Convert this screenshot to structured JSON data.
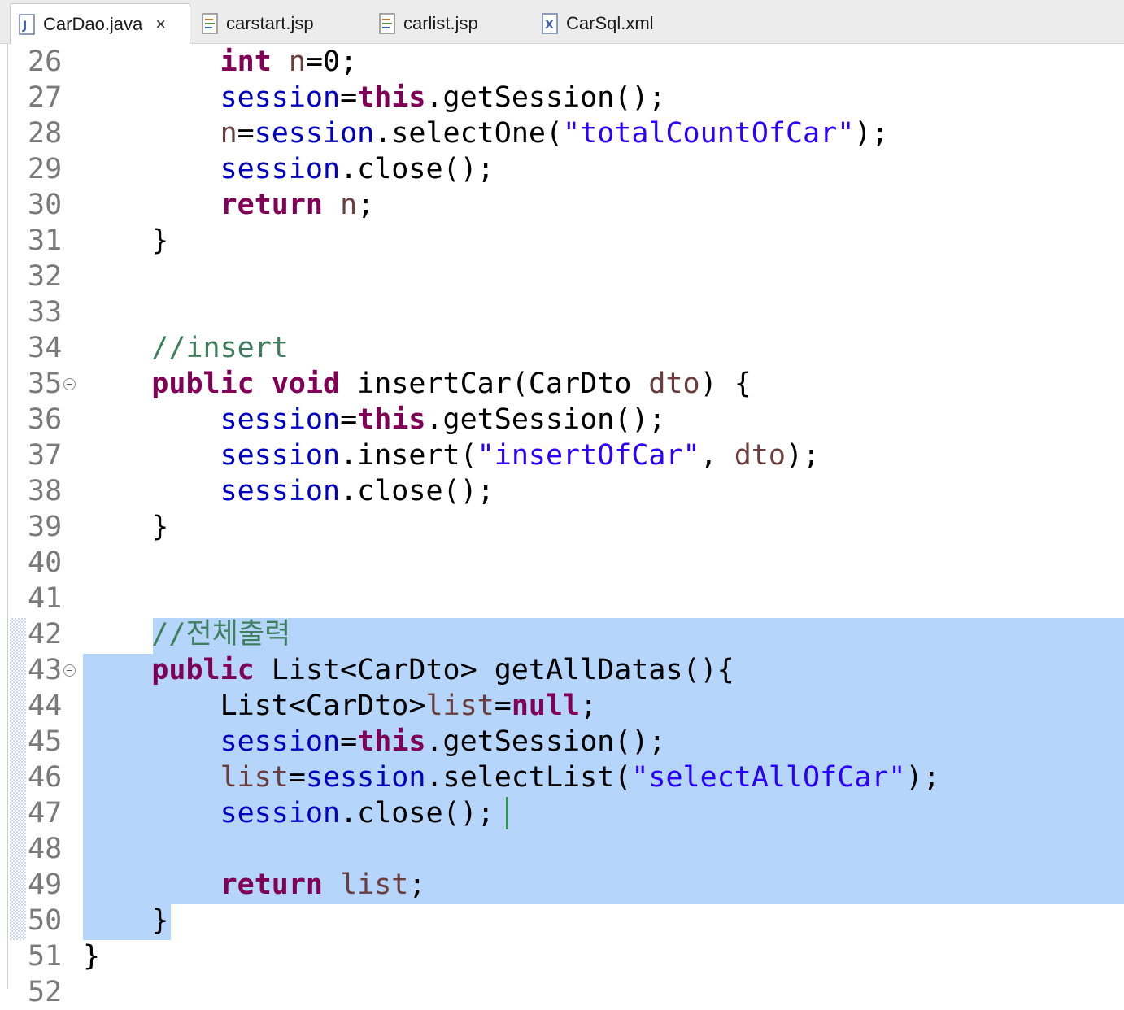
{
  "tabs": [
    {
      "label": "CarDao.java",
      "icon": "java-file-icon",
      "active": true
    },
    {
      "label": "carstart.jsp",
      "icon": "jsp-file-icon",
      "active": false
    },
    {
      "label": "carlist.jsp",
      "icon": "jsp-file-icon",
      "active": false
    },
    {
      "label": "CarSql.xml",
      "icon": "xml-file-icon",
      "active": false
    }
  ],
  "close_icon": "×",
  "colors": {
    "keyword": "#7f0055",
    "field": "#0000c0",
    "string": "#2a00ff",
    "local_var": "#6a3e3e",
    "comment": "#3f7f5f",
    "selection": "#b6d5fb"
  },
  "editor": {
    "lines": [
      {
        "num": "26",
        "tokens": [
          [
            "",
            "        "
          ],
          [
            "kw",
            "int"
          ],
          [
            "",
            " "
          ],
          [
            "var",
            "n"
          ],
          [
            "",
            "=0;"
          ]
        ]
      },
      {
        "num": "27",
        "tokens": [
          [
            "",
            "        "
          ],
          [
            "fld",
            "session"
          ],
          [
            "",
            "="
          ],
          [
            "kw",
            "this"
          ],
          [
            "",
            ".getSession();"
          ]
        ]
      },
      {
        "num": "28",
        "tokens": [
          [
            "",
            "        "
          ],
          [
            "var",
            "n"
          ],
          [
            "",
            "="
          ],
          [
            "fld",
            "session"
          ],
          [
            "",
            ".selectOne("
          ],
          [
            "str",
            "\"totalCountOfCar\""
          ],
          [
            "",
            ");"
          ]
        ]
      },
      {
        "num": "29",
        "tokens": [
          [
            "",
            "        "
          ],
          [
            "fld",
            "session"
          ],
          [
            "",
            ".close();"
          ]
        ]
      },
      {
        "num": "30",
        "tokens": [
          [
            "",
            "        "
          ],
          [
            "kw",
            "return"
          ],
          [
            "",
            " "
          ],
          [
            "var",
            "n"
          ],
          [
            "",
            ";"
          ]
        ]
      },
      {
        "num": "31",
        "tokens": [
          [
            "",
            "    }"
          ]
        ]
      },
      {
        "num": "32",
        "tokens": []
      },
      {
        "num": "33",
        "tokens": []
      },
      {
        "num": "34",
        "tokens": [
          [
            "",
            "    "
          ],
          [
            "cmt",
            "//insert"
          ]
        ]
      },
      {
        "num": "35",
        "fold": true,
        "tokens": [
          [
            "",
            "    "
          ],
          [
            "kw",
            "public"
          ],
          [
            "",
            " "
          ],
          [
            "kw",
            "void"
          ],
          [
            "",
            " insertCar(CarDto "
          ],
          [
            "var",
            "dto"
          ],
          [
            "",
            ") {"
          ]
        ]
      },
      {
        "num": "36",
        "tokens": [
          [
            "",
            "        "
          ],
          [
            "fld",
            "session"
          ],
          [
            "",
            "="
          ],
          [
            "kw",
            "this"
          ],
          [
            "",
            ".getSession();"
          ]
        ]
      },
      {
        "num": "37",
        "tokens": [
          [
            "",
            "        "
          ],
          [
            "fld",
            "session"
          ],
          [
            "",
            ".insert("
          ],
          [
            "str",
            "\"insertOfCar\""
          ],
          [
            "",
            ", "
          ],
          [
            "var",
            "dto"
          ],
          [
            "",
            ");"
          ]
        ]
      },
      {
        "num": "38",
        "tokens": [
          [
            "",
            "        "
          ],
          [
            "fld",
            "session"
          ],
          [
            "",
            ".close();"
          ]
        ]
      },
      {
        "num": "39",
        "tokens": [
          [
            "",
            "    }"
          ]
        ]
      },
      {
        "num": "40",
        "tokens": []
      },
      {
        "num": "41",
        "tokens": []
      },
      {
        "num": "42",
        "tokens": [
          [
            "",
            "    "
          ],
          [
            "cmt",
            "//전체출력"
          ]
        ]
      },
      {
        "num": "43",
        "fold": true,
        "tokens": [
          [
            "",
            "    "
          ],
          [
            "kw",
            "public"
          ],
          [
            "",
            " List<CarDto> getAllDatas(){"
          ]
        ]
      },
      {
        "num": "44",
        "tokens": [
          [
            "",
            "        List<CarDto>"
          ],
          [
            "var",
            "list"
          ],
          [
            "",
            "="
          ],
          [
            "kw",
            "null"
          ],
          [
            "",
            ";"
          ]
        ]
      },
      {
        "num": "45",
        "tokens": [
          [
            "",
            "        "
          ],
          [
            "fld",
            "session"
          ],
          [
            "",
            "="
          ],
          [
            "kw",
            "this"
          ],
          [
            "",
            ".getSession();"
          ]
        ]
      },
      {
        "num": "46",
        "tokens": [
          [
            "",
            "        "
          ],
          [
            "var",
            "list"
          ],
          [
            "",
            "="
          ],
          [
            "fld",
            "session"
          ],
          [
            "",
            ".selectList("
          ],
          [
            "str",
            "\"selectAllOfCar\""
          ],
          [
            "",
            ");"
          ]
        ]
      },
      {
        "num": "47",
        "tokens": [
          [
            "",
            "        "
          ],
          [
            "fld",
            "session"
          ],
          [
            "",
            ".close();"
          ]
        ]
      },
      {
        "num": "48",
        "tokens": []
      },
      {
        "num": "49",
        "tokens": [
          [
            "",
            "        "
          ],
          [
            "kw",
            "return"
          ],
          [
            "",
            " "
          ],
          [
            "var",
            "list"
          ],
          [
            "",
            ";"
          ]
        ]
      },
      {
        "num": "50",
        "tokens": [
          [
            "",
            "    }"
          ]
        ]
      },
      {
        "num": "51",
        "tokens": [
          [
            "",
            "}"
          ]
        ]
      },
      {
        "num": "52",
        "tokens": []
      }
    ]
  }
}
